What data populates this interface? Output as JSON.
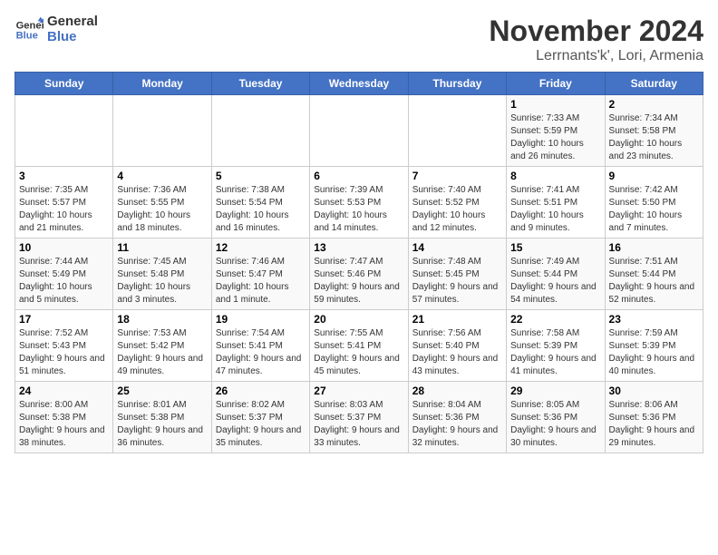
{
  "logo": {
    "line1": "General",
    "line2": "Blue"
  },
  "title": "November 2024",
  "subtitle": "Lerrnants'k', Lori, Armenia",
  "weekdays": [
    "Sunday",
    "Monday",
    "Tuesday",
    "Wednesday",
    "Thursday",
    "Friday",
    "Saturday"
  ],
  "weeks": [
    [
      {
        "day": "",
        "info": ""
      },
      {
        "day": "",
        "info": ""
      },
      {
        "day": "",
        "info": ""
      },
      {
        "day": "",
        "info": ""
      },
      {
        "day": "",
        "info": ""
      },
      {
        "day": "1",
        "info": "Sunrise: 7:33 AM\nSunset: 5:59 PM\nDaylight: 10 hours and 26 minutes."
      },
      {
        "day": "2",
        "info": "Sunrise: 7:34 AM\nSunset: 5:58 PM\nDaylight: 10 hours and 23 minutes."
      }
    ],
    [
      {
        "day": "3",
        "info": "Sunrise: 7:35 AM\nSunset: 5:57 PM\nDaylight: 10 hours and 21 minutes."
      },
      {
        "day": "4",
        "info": "Sunrise: 7:36 AM\nSunset: 5:55 PM\nDaylight: 10 hours and 18 minutes."
      },
      {
        "day": "5",
        "info": "Sunrise: 7:38 AM\nSunset: 5:54 PM\nDaylight: 10 hours and 16 minutes."
      },
      {
        "day": "6",
        "info": "Sunrise: 7:39 AM\nSunset: 5:53 PM\nDaylight: 10 hours and 14 minutes."
      },
      {
        "day": "7",
        "info": "Sunrise: 7:40 AM\nSunset: 5:52 PM\nDaylight: 10 hours and 12 minutes."
      },
      {
        "day": "8",
        "info": "Sunrise: 7:41 AM\nSunset: 5:51 PM\nDaylight: 10 hours and 9 minutes."
      },
      {
        "day": "9",
        "info": "Sunrise: 7:42 AM\nSunset: 5:50 PM\nDaylight: 10 hours and 7 minutes."
      }
    ],
    [
      {
        "day": "10",
        "info": "Sunrise: 7:44 AM\nSunset: 5:49 PM\nDaylight: 10 hours and 5 minutes."
      },
      {
        "day": "11",
        "info": "Sunrise: 7:45 AM\nSunset: 5:48 PM\nDaylight: 10 hours and 3 minutes."
      },
      {
        "day": "12",
        "info": "Sunrise: 7:46 AM\nSunset: 5:47 PM\nDaylight: 10 hours and 1 minute."
      },
      {
        "day": "13",
        "info": "Sunrise: 7:47 AM\nSunset: 5:46 PM\nDaylight: 9 hours and 59 minutes."
      },
      {
        "day": "14",
        "info": "Sunrise: 7:48 AM\nSunset: 5:45 PM\nDaylight: 9 hours and 57 minutes."
      },
      {
        "day": "15",
        "info": "Sunrise: 7:49 AM\nSunset: 5:44 PM\nDaylight: 9 hours and 54 minutes."
      },
      {
        "day": "16",
        "info": "Sunrise: 7:51 AM\nSunset: 5:44 PM\nDaylight: 9 hours and 52 minutes."
      }
    ],
    [
      {
        "day": "17",
        "info": "Sunrise: 7:52 AM\nSunset: 5:43 PM\nDaylight: 9 hours and 51 minutes."
      },
      {
        "day": "18",
        "info": "Sunrise: 7:53 AM\nSunset: 5:42 PM\nDaylight: 9 hours and 49 minutes."
      },
      {
        "day": "19",
        "info": "Sunrise: 7:54 AM\nSunset: 5:41 PM\nDaylight: 9 hours and 47 minutes."
      },
      {
        "day": "20",
        "info": "Sunrise: 7:55 AM\nSunset: 5:41 PM\nDaylight: 9 hours and 45 minutes."
      },
      {
        "day": "21",
        "info": "Sunrise: 7:56 AM\nSunset: 5:40 PM\nDaylight: 9 hours and 43 minutes."
      },
      {
        "day": "22",
        "info": "Sunrise: 7:58 AM\nSunset: 5:39 PM\nDaylight: 9 hours and 41 minutes."
      },
      {
        "day": "23",
        "info": "Sunrise: 7:59 AM\nSunset: 5:39 PM\nDaylight: 9 hours and 40 minutes."
      }
    ],
    [
      {
        "day": "24",
        "info": "Sunrise: 8:00 AM\nSunset: 5:38 PM\nDaylight: 9 hours and 38 minutes."
      },
      {
        "day": "25",
        "info": "Sunrise: 8:01 AM\nSunset: 5:38 PM\nDaylight: 9 hours and 36 minutes."
      },
      {
        "day": "26",
        "info": "Sunrise: 8:02 AM\nSunset: 5:37 PM\nDaylight: 9 hours and 35 minutes."
      },
      {
        "day": "27",
        "info": "Sunrise: 8:03 AM\nSunset: 5:37 PM\nDaylight: 9 hours and 33 minutes."
      },
      {
        "day": "28",
        "info": "Sunrise: 8:04 AM\nSunset: 5:36 PM\nDaylight: 9 hours and 32 minutes."
      },
      {
        "day": "29",
        "info": "Sunrise: 8:05 AM\nSunset: 5:36 PM\nDaylight: 9 hours and 30 minutes."
      },
      {
        "day": "30",
        "info": "Sunrise: 8:06 AM\nSunset: 5:36 PM\nDaylight: 9 hours and 29 minutes."
      }
    ]
  ]
}
